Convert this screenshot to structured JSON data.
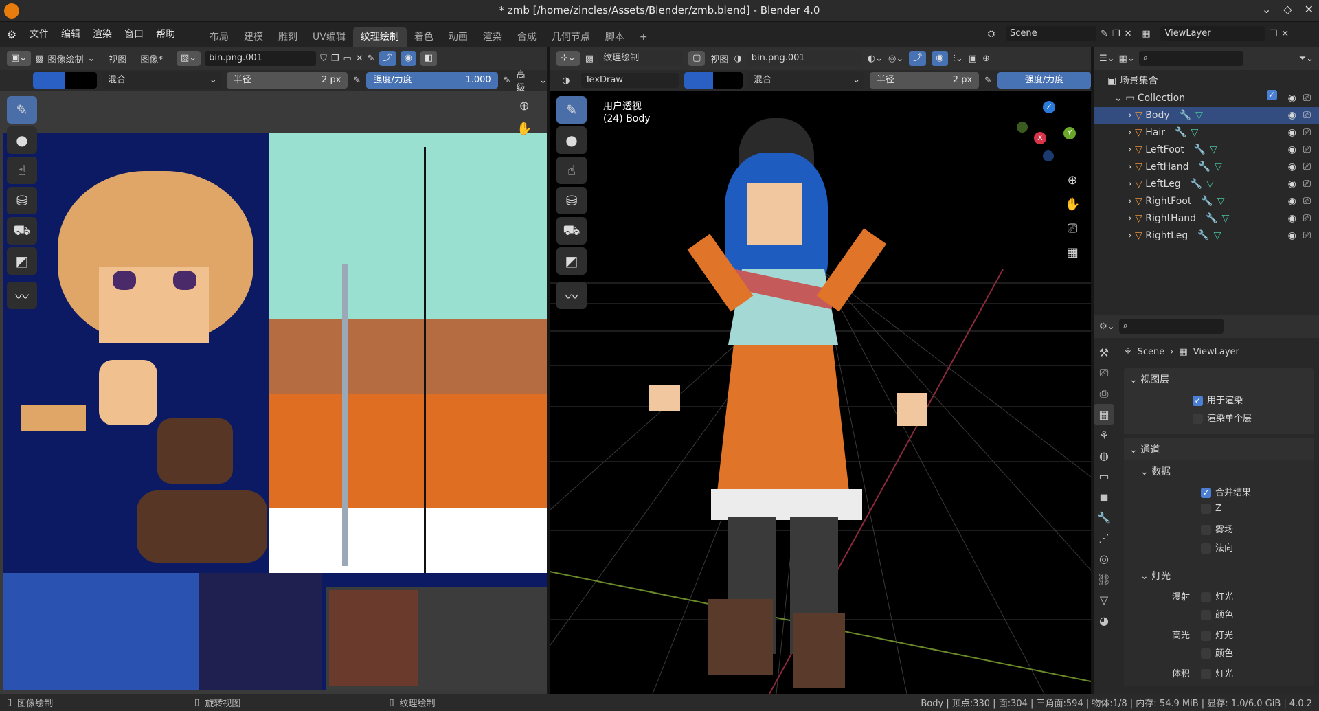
{
  "window": {
    "title": "* zmb [/home/zincles/Assets/Blender/zmb.blend] - Blender 4.0",
    "controls": [
      "minimize",
      "maximize",
      "close"
    ]
  },
  "menubar": {
    "items": [
      "文件",
      "编辑",
      "渲染",
      "窗口",
      "帮助"
    ],
    "workspaces": [
      "布局",
      "建模",
      "雕刻",
      "UV编辑",
      "纹理绘制",
      "着色",
      "动画",
      "渲染",
      "合成",
      "几何节点",
      "脚本"
    ],
    "active_workspace": "纹理绘制",
    "scene": "Scene",
    "view_layer": "ViewLayer"
  },
  "image_editor": {
    "mode": "图像绘制",
    "view_menu": "视图",
    "image_menu": "图像*",
    "image_name": "bin.png.001",
    "blend_mode": "混合",
    "radius_label": "半径",
    "radius_value": "2 px",
    "strength_label": "强度/力度",
    "strength_value": "1.000",
    "advanced_label": "高级",
    "color_primary": "#2a5fc4",
    "color_secondary": "#000000"
  },
  "viewport": {
    "mode": "纹理绘制",
    "view_menu": "视图",
    "image_name": "bin.png.001",
    "texture_slot": "TexDraw",
    "blend_mode": "混合",
    "radius_label": "半径",
    "radius_value": "2 px",
    "strength_label": "强度/力度",
    "overlay_line1": "用户透视",
    "overlay_line2": "(24) Body",
    "gizmo": {
      "x": "X",
      "y": "Y",
      "z": "Z"
    }
  },
  "outliner": {
    "search_placeholder": "",
    "root": "场景集合",
    "collection": "Collection",
    "objects": [
      "Body",
      "Hair",
      "LeftFoot",
      "LeftHand",
      "LeftLeg",
      "RightFoot",
      "RightHand",
      "RightLeg"
    ],
    "selected": "Body"
  },
  "properties": {
    "breadcrumb_scene": "Scene",
    "breadcrumb_layer": "ViewLayer",
    "panel_view_layer": "视图层",
    "use_for_render": "用于渲染",
    "render_single_layer": "渲染单个层",
    "panel_passes": "通道",
    "sub_data": "数据",
    "combined": "合并结果",
    "z": "Z",
    "mist": "雾场",
    "normal": "法向",
    "sub_light": "灯光",
    "diffuse_label": "漫射",
    "glossy_label": "高光",
    "volume_label": "体积",
    "light_opt": "灯光",
    "color_opt": "颜色"
  },
  "statusbar": {
    "left1": "图像绘制",
    "left2": "旋转视图",
    "left3": "纹理绘制",
    "stats": "Body | 顶点:330 | 面:304 | 三角面:594 | 物体:1/8 | 内存: 54.9 MiB | 显存: 1.0/6.0 GiB | 4.0.2"
  }
}
